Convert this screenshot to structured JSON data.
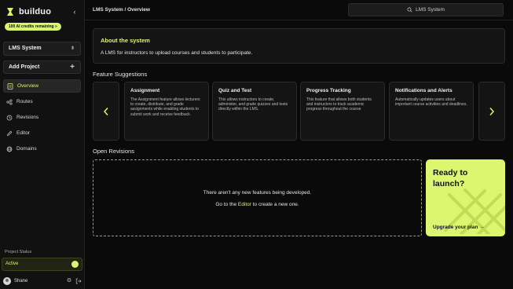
{
  "brand": {
    "name": "builduo",
    "credits_badge": "100 AI credits remaining »"
  },
  "sidebar": {
    "project": "LMS System",
    "add_project": "Add Project",
    "nav": [
      {
        "label": "Overview",
        "icon": "overview-icon",
        "active": true
      },
      {
        "label": "Routes",
        "icon": "routes-icon",
        "active": false
      },
      {
        "label": "Revisions",
        "icon": "revisions-icon",
        "active": false
      },
      {
        "label": "Editor",
        "icon": "editor-icon",
        "active": false
      },
      {
        "label": "Domains",
        "icon": "globe-icon",
        "active": false
      }
    ],
    "status_label": "Project Status",
    "status_value": "Active",
    "user_name": "Shane"
  },
  "topbar": {
    "breadcrumb": "LMS System / Overview",
    "search_value": "LMS System"
  },
  "about": {
    "title": "About the system",
    "text": "A LMS for instructors to upload courses and students to participate."
  },
  "features": {
    "heading": "Feature Suggestions",
    "cards": [
      {
        "title": "Assignment",
        "desc": "The Assignment feature allows lecturers to create, distribute, and grade assignments while enabling students to submit work and receive feedback."
      },
      {
        "title": "Quiz and Test",
        "desc": "This allows instructors to create, administer, and grade quizzes and tests directly within the LMS."
      },
      {
        "title": "Progress Tracking",
        "desc": "This feature that allows both students and instructors to track academic progress throughout the course"
      },
      {
        "title": "Notifications and Alerts",
        "desc": "Automatically updates users about important course activities and deadlines."
      }
    ]
  },
  "revisions": {
    "heading": "Open Revisions",
    "empty_text": "There aren't any new features being developed.",
    "cta_prefix": "Go to the",
    "cta_link": "Editor",
    "cta_suffix": "to create a new one."
  },
  "launch": {
    "title": "Ready to launch?",
    "cta": "Upgrade your plan →"
  },
  "colors": {
    "accent": "#d9f56c",
    "background": "#0a0a0a",
    "panel": "#141414"
  }
}
